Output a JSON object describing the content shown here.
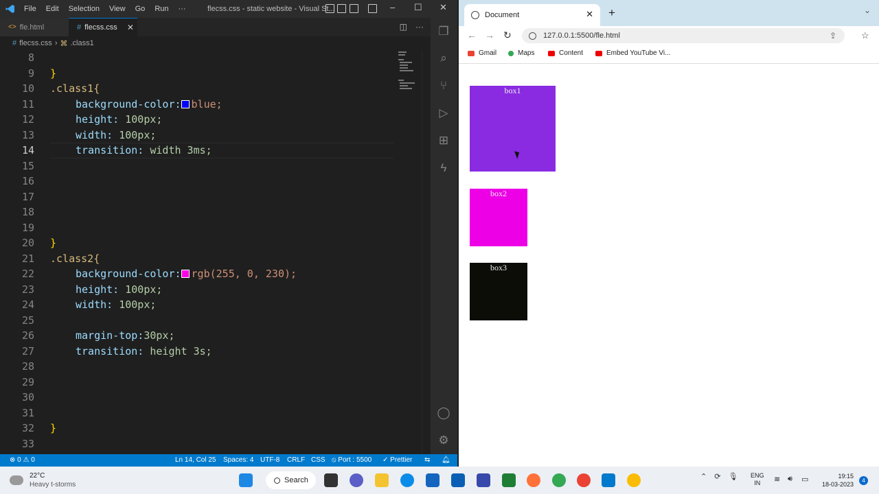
{
  "vscode": {
    "menu": [
      "File",
      "Edit",
      "Selection",
      "View",
      "Go",
      "Run",
      "···"
    ],
    "window_title": "flecss.css - static website - Visual St...",
    "tabs": [
      {
        "label": "fle.html"
      },
      {
        "label": "flecss.css"
      }
    ],
    "breadcrumbs": {
      "file": "flecss.css",
      "symbol": ".class1"
    },
    "code_lines": [
      {
        "num": "8",
        "text": ""
      },
      {
        "num": "9",
        "text": "}"
      },
      {
        "num": "10",
        "text": ".class1{"
      },
      {
        "num": "11",
        "text": "background-color:",
        "value": "blue;",
        "swatch": "#0000ff"
      },
      {
        "num": "12",
        "text": "height: 100px;"
      },
      {
        "num": "13",
        "text": "width: 100px;"
      },
      {
        "num": "14",
        "text": "transition: width 3ms;"
      },
      {
        "num": "15",
        "text": ""
      },
      {
        "num": "16",
        "text": ""
      },
      {
        "num": "17",
        "text": ""
      },
      {
        "num": "18",
        "text": ""
      },
      {
        "num": "19",
        "text": ""
      },
      {
        "num": "20",
        "text": "}"
      },
      {
        "num": "21",
        "text": ".class2{"
      },
      {
        "num": "22",
        "text": "background-color:",
        "value": "rgb(255, 0, 230);",
        "swatch": "#ff00e6"
      },
      {
        "num": "23",
        "text": "height: 100px;"
      },
      {
        "num": "24",
        "text": "width: 100px;"
      },
      {
        "num": "25",
        "text": ""
      },
      {
        "num": "26",
        "text": "margin-top:30px;"
      },
      {
        "num": "27",
        "text": "transition: height 3s;"
      },
      {
        "num": "28",
        "text": ""
      },
      {
        "num": "29",
        "text": ""
      },
      {
        "num": "30",
        "text": ""
      },
      {
        "num": "31",
        "text": ""
      },
      {
        "num": "32",
        "text": "}"
      },
      {
        "num": "33",
        "text": ""
      }
    ],
    "status": {
      "problems": "⊗ 0 ⚠ 0",
      "position": "Ln 14, Col 25",
      "spaces": "Spaces: 4",
      "encoding": "UTF-8",
      "eol": "CRLF",
      "language": "CSS",
      "port": "⦸ Port : 5500",
      "prettier": "✓ Prettier"
    }
  },
  "browser": {
    "tab_title": "Document",
    "url": "127.0.0.1:5500/fle.html",
    "bookmarks": [
      "Gmail",
      "Maps",
      "Content",
      "Embed YouTube Vi..."
    ],
    "boxes": [
      {
        "label": "box1",
        "color": "#8a2be2"
      },
      {
        "label": "box2",
        "color": "#ee00e6"
      },
      {
        "label": "box3",
        "color": "#0d0d08"
      }
    ]
  },
  "taskbar": {
    "weather_temp": "22°C",
    "weather_desc": "Heavy t-storms",
    "search_label": "Search",
    "lang_1": "ENG",
    "lang_2": "IN",
    "time": "19:15",
    "date": "18-03-2023",
    "notifications": "4"
  }
}
